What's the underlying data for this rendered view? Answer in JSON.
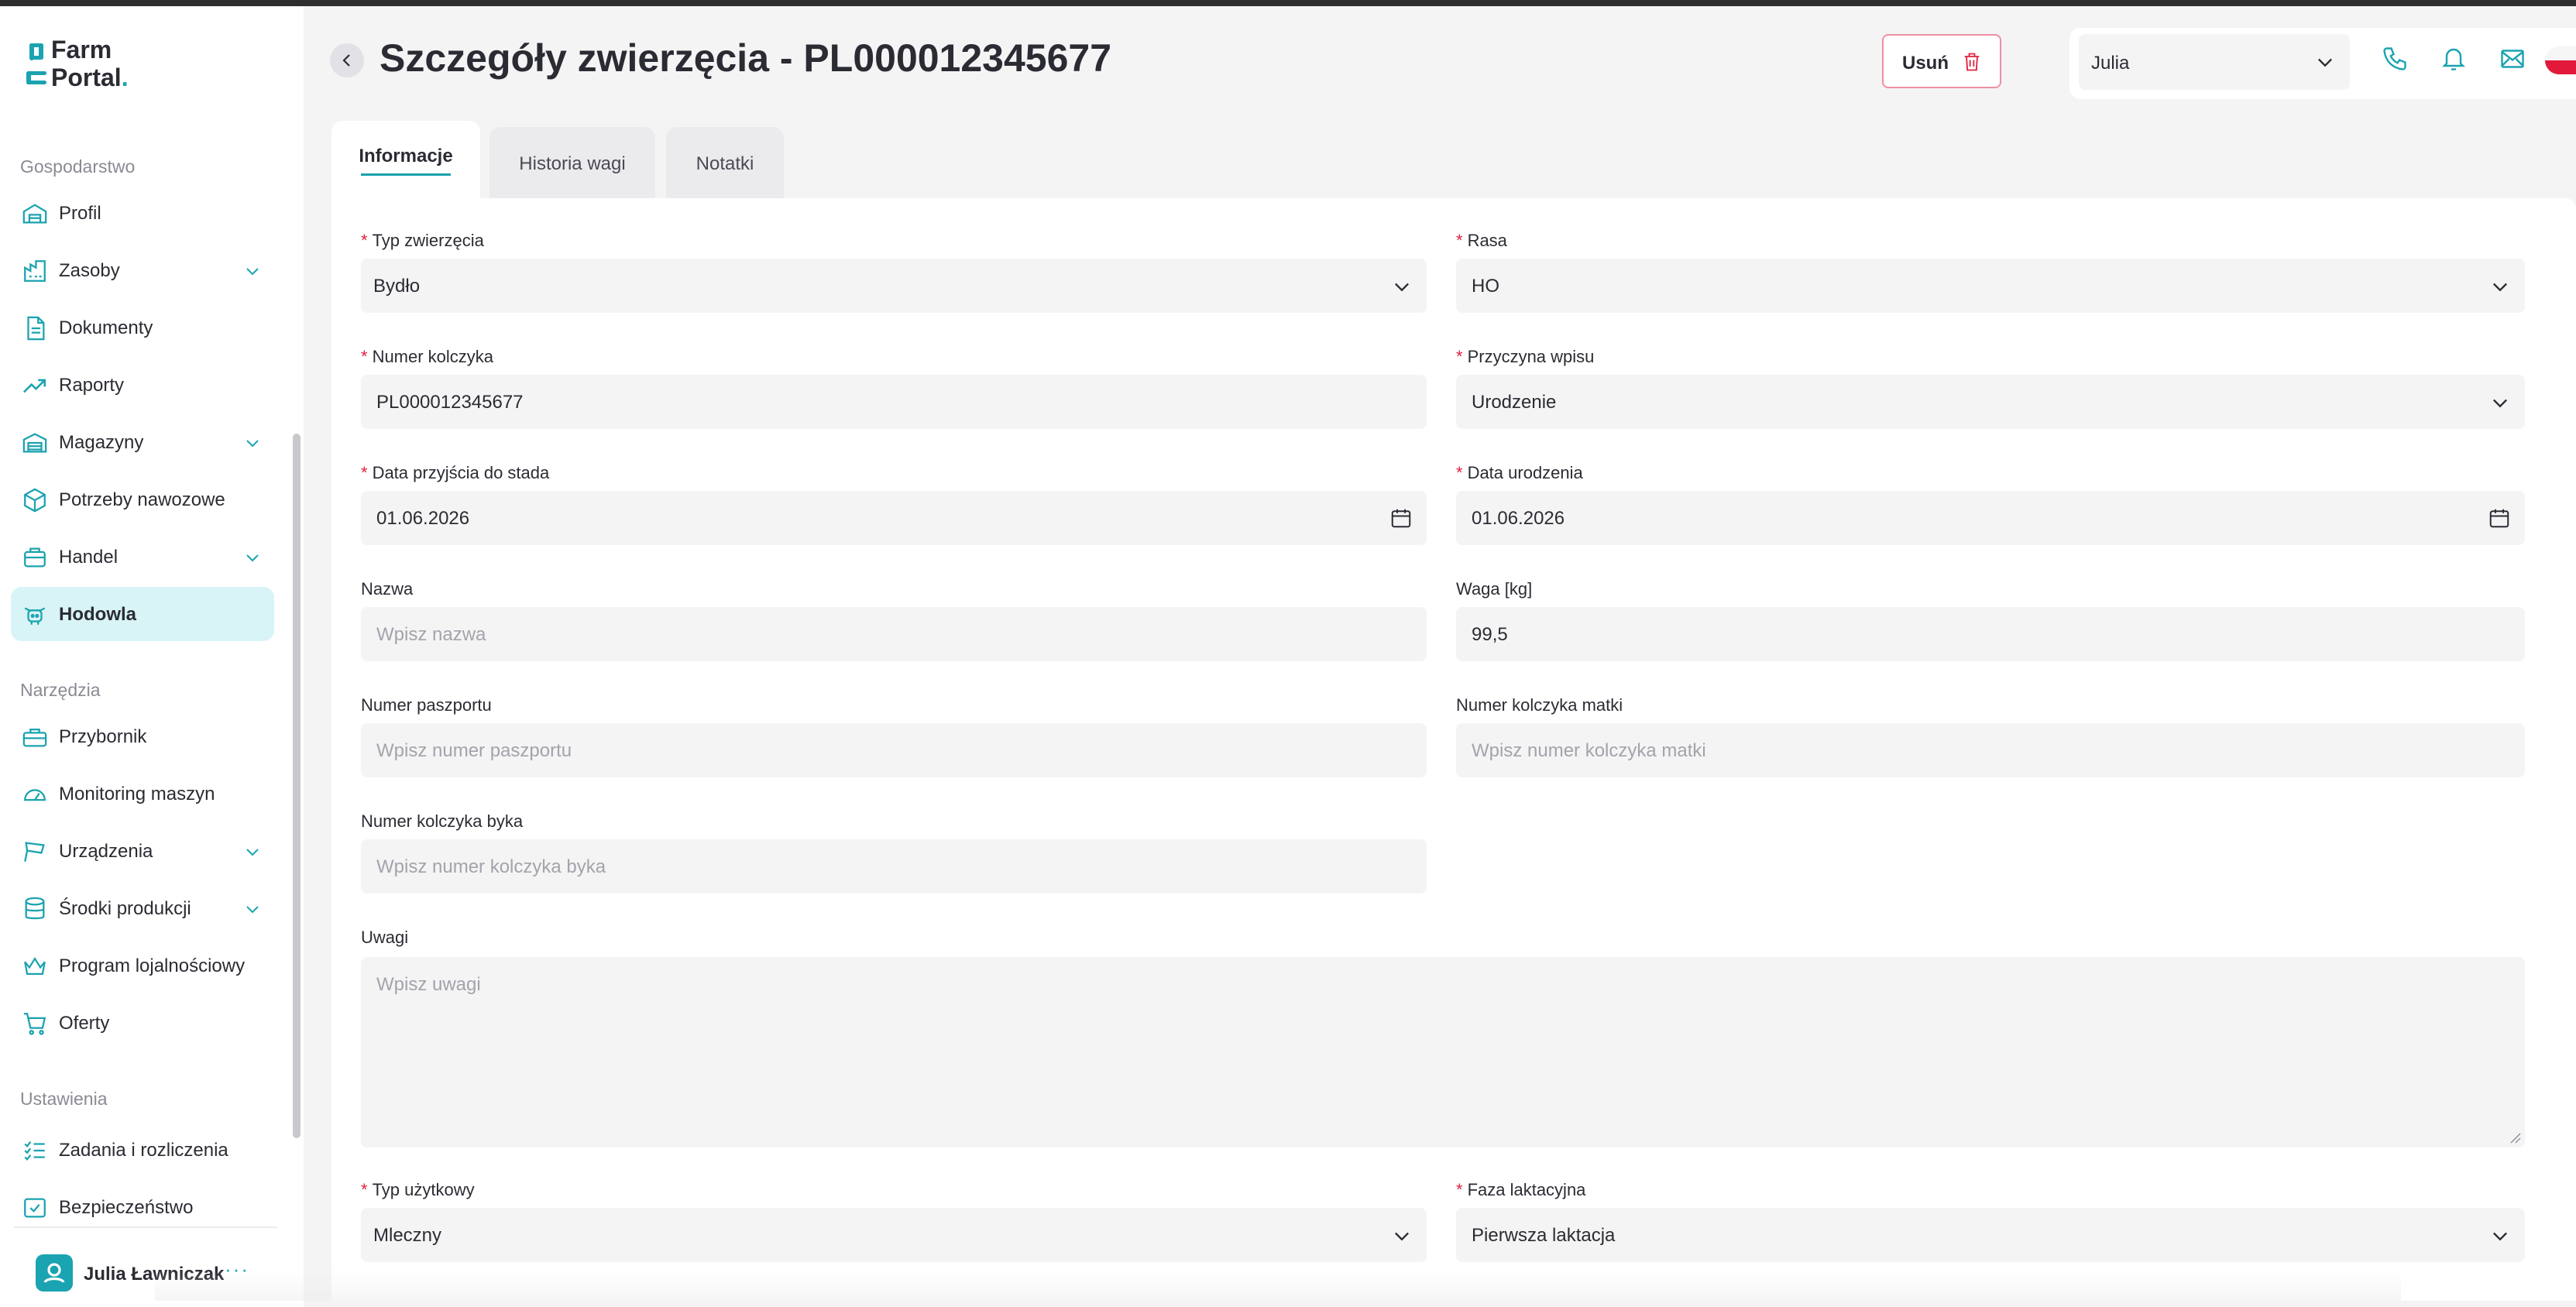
{
  "app": {
    "logo_line1": "Farm",
    "logo_line2": "Portal",
    "logo_dot": "."
  },
  "sidebar": {
    "sections": [
      {
        "title": "Gospodarstwo"
      },
      {
        "title": "Narzędzia"
      },
      {
        "title": "Ustawienia"
      }
    ],
    "items": [
      {
        "label": "Profil",
        "icon": "farm-house-icon"
      },
      {
        "label": "Zasoby",
        "icon": "resources-chart-icon",
        "expandable": true
      },
      {
        "label": "Dokumenty",
        "icon": "document-icon"
      },
      {
        "label": "Raporty",
        "icon": "trend-up-icon"
      },
      {
        "label": "Magazyny",
        "icon": "warehouse-icon",
        "expandable": true
      },
      {
        "label": "Potrzeby nawozowe",
        "icon": "fertilizer-icon"
      },
      {
        "label": "Handel",
        "icon": "trade-box-icon",
        "expandable": true
      },
      {
        "label": "Hodowla",
        "icon": "cow-icon",
        "active": true
      },
      {
        "label": "Przybornik",
        "icon": "toolbox-icon"
      },
      {
        "label": "Monitoring maszyn",
        "icon": "gauge-icon"
      },
      {
        "label": "Urządzenia",
        "icon": "devices-icon",
        "expandable": true
      },
      {
        "label": "Środki produkcji",
        "icon": "database-icon",
        "expandable": true
      },
      {
        "label": "Program lojalnościowy",
        "icon": "crown-icon"
      },
      {
        "label": "Oferty",
        "icon": "cart-icon"
      },
      {
        "label": "Zadania i rozliczenia",
        "icon": "task-list-icon"
      },
      {
        "label": "Bezpieczeństwo",
        "icon": "shield-check-icon"
      }
    ],
    "user": {
      "name": "Julia Ławniczak",
      "more": "···"
    }
  },
  "header": {
    "title": "Szczegóły zwierzęcia - PL000012345677",
    "delete_label": "Usuń",
    "user_select_value": "Julia"
  },
  "tabs": [
    {
      "label": "Informacje",
      "active": true
    },
    {
      "label": "Historia wagi"
    },
    {
      "label": "Notatki"
    }
  ],
  "form": {
    "animal_type": {
      "label": "Typ zwierzęcia",
      "required": true,
      "value": "Bydło"
    },
    "breed": {
      "label": "Rasa",
      "required": true,
      "value": "HO"
    },
    "ear_tag": {
      "label": "Numer kolczyka",
      "required": true,
      "value": "PL000012345677"
    },
    "entry_reason": {
      "label": "Przyczyna wpisu",
      "required": true,
      "value": "Urodzenie"
    },
    "herd_arrival_date": {
      "label": "Data przyjścia do stada",
      "required": true,
      "value": "01.06.2026"
    },
    "birth_date": {
      "label": "Data urodzenia",
      "required": true,
      "value": "01.06.2026"
    },
    "name": {
      "label": "Nazwa",
      "placeholder": "Wpisz nazwa"
    },
    "weight": {
      "label": "Waga [kg]",
      "value": "99,5"
    },
    "passport": {
      "label": "Numer paszportu",
      "placeholder": "Wpisz numer paszportu"
    },
    "mother_tag": {
      "label": "Numer kolczyka matki",
      "placeholder": "Wpisz numer kolczyka matki"
    },
    "bull_tag": {
      "label": "Numer kolczyka byka",
      "placeholder": "Wpisz numer kolczyka byka"
    },
    "notes": {
      "label": "Uwagi",
      "placeholder": "Wpisz uwagi"
    },
    "usage_type": {
      "label": "Typ użytkowy",
      "required": true,
      "value": "Mleczny"
    },
    "lactation_phase": {
      "label": "Faza laktacyjna",
      "required": true,
      "value": "Pierwsza laktacja"
    }
  },
  "colors": {
    "accent": "#1aa3b0",
    "active_bg": "#d8f4f6",
    "danger": "#e0223f",
    "delete_border": "#ee8fa2"
  }
}
